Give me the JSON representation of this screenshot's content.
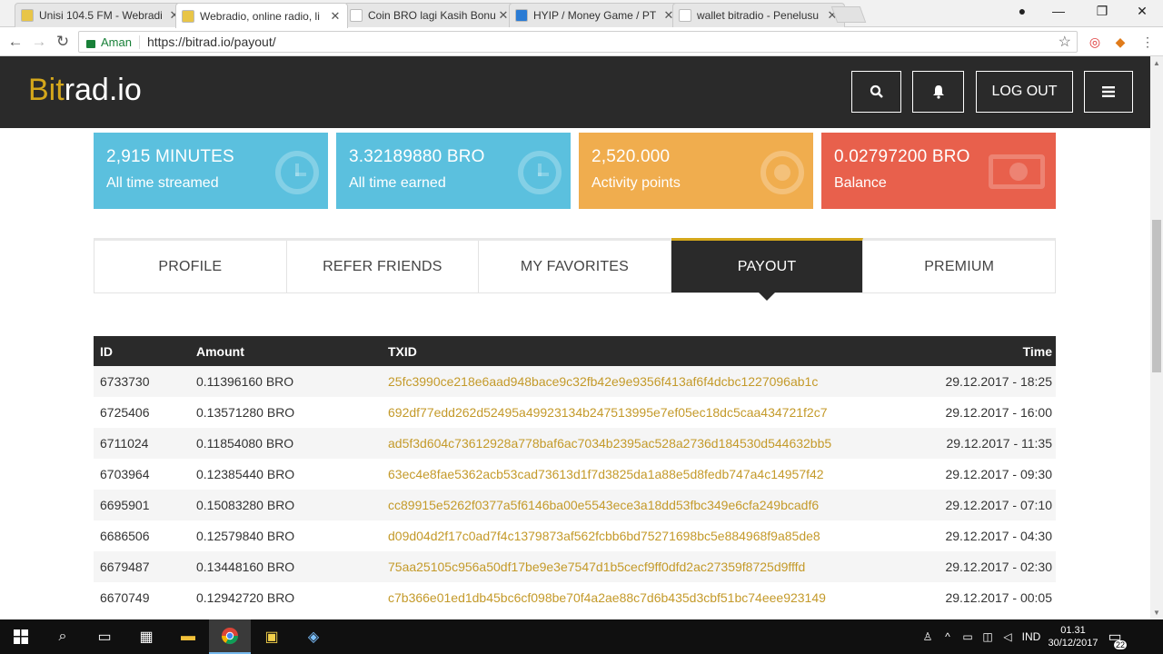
{
  "browser": {
    "tabs": [
      {
        "title": "Unisi 104.5 FM - Webradi",
        "favicon_color": "#e8c547",
        "active": false
      },
      {
        "title": "Webradio, online radio, li",
        "favicon_color": "#e8c547",
        "active": true
      },
      {
        "title": "Coin BRO lagi Kasih Bonu",
        "favicon_color": "#ffffff",
        "active": false
      },
      {
        "title": "HYIP / Money Game / PT",
        "favicon_color": "#2a7bd4",
        "active": false
      },
      {
        "title": "wallet bitradio - Penelusu",
        "favicon_color": "#ffffff",
        "active": false
      }
    ],
    "secure_label": "Aman",
    "url": "https://bitrad.io/payout/"
  },
  "site": {
    "logo_bit": "Bit",
    "logo_rest": "rad.io",
    "logout_label": "LOG OUT",
    "accent": "#d4a71b",
    "header_bg": "#2a2a2a"
  },
  "stats": [
    {
      "value": "2,915 MINUTES",
      "label": "All time streamed",
      "color": "#5bc0de",
      "icon": "clock-icon"
    },
    {
      "value": "3.32189880 BRO",
      "label": "All time earned",
      "color": "#5bc0de",
      "icon": "clock-icon"
    },
    {
      "value": "2,520.000",
      "label": "Activity points",
      "color": "#f0ad4e",
      "icon": "target-icon"
    },
    {
      "value": "0.02797200 BRO",
      "label": "Balance",
      "color": "#e8604c",
      "icon": "money-icon"
    }
  ],
  "nav_tabs": [
    {
      "label": "PROFILE",
      "active": false
    },
    {
      "label": "REFER FRIENDS",
      "active": false
    },
    {
      "label": "MY FAVORITES",
      "active": false
    },
    {
      "label": "PAYOUT",
      "active": true
    },
    {
      "label": "PREMIUM",
      "active": false
    }
  ],
  "table": {
    "headers": {
      "id": "ID",
      "amount": "Amount",
      "txid": "TXID",
      "time": "Time"
    },
    "rows": [
      {
        "id": "6733730",
        "amount": "0.11396160 BRO",
        "txid": "25fc3990ce218e6aad948bace9c32fb42e9e9356f413af6f4dcbc1227096ab1c",
        "time": "29.12.2017 - 18:25"
      },
      {
        "id": "6725406",
        "amount": "0.13571280 BRO",
        "txid": "692df77edd262d52495a49923134b247513995e7ef05ec18dc5caa434721f2c7",
        "time": "29.12.2017 - 16:00"
      },
      {
        "id": "6711024",
        "amount": "0.11854080 BRO",
        "txid": "ad5f3d604c73612928a778baf6ac7034b2395ac528a2736d184530d544632bb5",
        "time": "29.12.2017 - 11:35"
      },
      {
        "id": "6703964",
        "amount": "0.12385440 BRO",
        "txid": "63ec4e8fae5362acb53cad73613d1f7d3825da1a88e5d8fedb747a4c14957f42",
        "time": "29.12.2017 - 09:30"
      },
      {
        "id": "6695901",
        "amount": "0.15083280 BRO",
        "txid": "cc89915e5262f0377a5f6146ba00e5543ece3a18dd53fbc349e6cfa249bcadf6",
        "time": "29.12.2017 - 07:10"
      },
      {
        "id": "6686506",
        "amount": "0.12579840 BRO",
        "txid": "d09d04d2f17c0ad7f4c1379873af562fcbb6bd75271698bc5e884968f9a85de8",
        "time": "29.12.2017 - 04:30"
      },
      {
        "id": "6679487",
        "amount": "0.13448160 BRO",
        "txid": "75aa25105c956a50df17be9e3e7547d1b5cecf9ff0dfd2ac27359f8725d9fffd",
        "time": "29.12.2017 - 02:30"
      },
      {
        "id": "6670749",
        "amount": "0.12942720 BRO",
        "txid": "c7b366e01ed1db45bc6cf098be70f4a2ae88c7d6b435d3cbf51bc74eee923149",
        "time": "29.12.2017 - 00:05"
      }
    ]
  },
  "taskbar": {
    "language": "IND",
    "time": "01.31",
    "date": "30/12/2017",
    "notification_count": "22"
  }
}
